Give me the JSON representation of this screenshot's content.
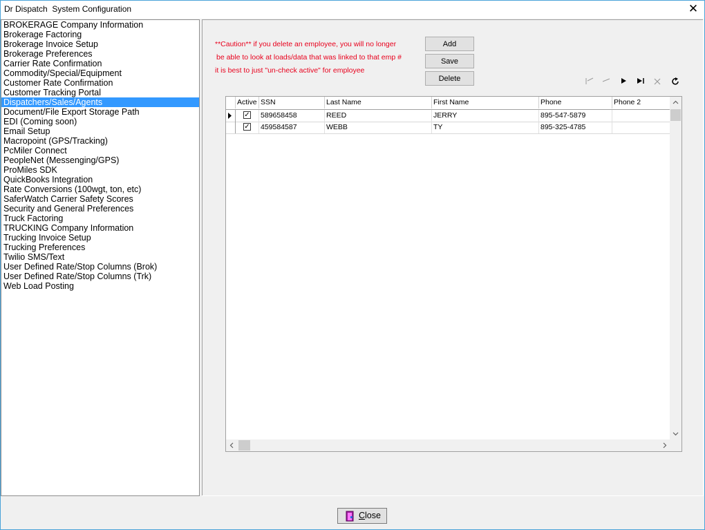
{
  "window": {
    "title": "Dr Dispatch  System Configuration",
    "close_glyph": "✕"
  },
  "sidebar": {
    "items": [
      "BROKERAGE Company Information",
      "Brokerage Factoring",
      "Brokerage Invoice Setup",
      "Brokerage Preferences",
      "Carrier Rate Confirmation",
      "Commodity/Special/Equipment",
      "Customer Rate Confirmation",
      "Customer Tracking Portal",
      "Dispatchers/Sales/Agents",
      "Document/File Export Storage Path",
      "EDI (Coming soon)",
      "Email Setup",
      "Macropoint (GPS/Tracking)",
      "PcMiler Connect",
      "PeopleNet (Messenging/GPS)",
      "ProMiles SDK",
      "QuickBooks Integration",
      "Rate Conversions (100wgt, ton, etc)",
      "SaferWatch Carrier Safety Scores",
      "Security and General Preferences",
      "Truck Factoring",
      "TRUCKING Company Information",
      "Trucking Invoice Setup",
      "Trucking Preferences",
      "Twilio SMS/Text",
      "User Defined Rate/Stop Columns (Brok)",
      "User Defined Rate/Stop Columns (Trk)",
      "Web Load Posting"
    ],
    "selected": "Dispatchers/Sales/Agents"
  },
  "caution": {
    "line1": "**Caution** if you delete an employee, you will no longer",
    "line2": "be able to look at loads/data that was linked to that emp #",
    "line3": "it is best to just \"un-check active\" for employee"
  },
  "buttons": {
    "add": "Add",
    "save": "Save",
    "delete": "Delete"
  },
  "grid": {
    "columns": [
      "Active",
      "SSN",
      "Last Name",
      "First Name",
      "Phone",
      "Phone 2"
    ],
    "rows": [
      {
        "active": true,
        "ssn": "589658458",
        "last": "REED",
        "first": "JERRY",
        "phone": "895-547-5879",
        "phone2": ""
      },
      {
        "active": true,
        "ssn": "459584587",
        "last": "WEBB",
        "first": "TY",
        "phone": "895-325-4785",
        "phone2": ""
      }
    ]
  },
  "close_button": {
    "label": "Close"
  }
}
